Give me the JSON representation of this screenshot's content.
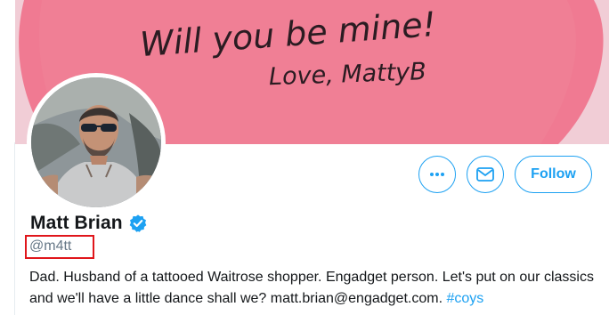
{
  "banner": {
    "note_line1": "Will you be mine!",
    "note_line2": "Love, MattyB"
  },
  "profile": {
    "display_name": "Matt Brian",
    "handle": "@m4tt",
    "bio_text": "Dad. Husband of a tattooed Waitrose shopper. Engadget person. Let's put on our classics and we'll have a little dance shall we? matt.brian@engadget.com. ",
    "bio_hashtag": "#coys"
  },
  "actions": {
    "follow_label": "Follow"
  },
  "colors": {
    "accent": "#1da1f2",
    "banner_pink": "#f07a92",
    "highlight_box": "#e0161b"
  }
}
